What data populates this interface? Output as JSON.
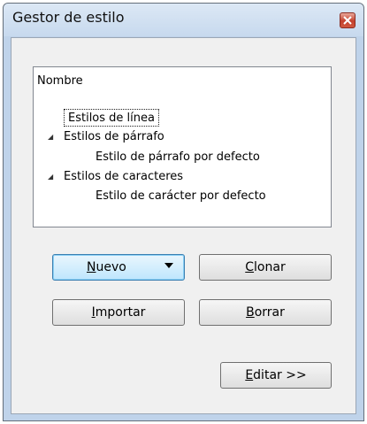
{
  "window": {
    "title": "Gestor de estilo"
  },
  "tree": {
    "header": "Nombre",
    "items": [
      {
        "label": "Estilos de línea",
        "level": 0,
        "expanded": false,
        "selected": true
      },
      {
        "label": "Estilos de párrafo",
        "level": 0,
        "expanded": true,
        "selected": false
      },
      {
        "label": "Estilo de párrafo por defecto",
        "level": 1,
        "selected": false
      },
      {
        "label": "Estilos de caracteres",
        "level": 0,
        "expanded": true,
        "selected": false
      },
      {
        "label": "Estilo de carácter por defecto",
        "level": 1,
        "selected": false
      }
    ]
  },
  "buttons": {
    "nuevo": {
      "label": "Nuevo",
      "mnemonic": "N",
      "rest": "uevo"
    },
    "clonar": {
      "label": "Clonar",
      "mnemonic": "C",
      "rest": "lonar"
    },
    "importar": {
      "label": "Importar",
      "mnemonic": "I",
      "rest": "mportar"
    },
    "borrar": {
      "label": "Borrar",
      "mnemonic": "B",
      "rest": "orrar"
    },
    "editar": {
      "label": "Editar >>",
      "mnemonic": "E",
      "rest": "ditar >>"
    }
  },
  "icons": {
    "close": "close-icon",
    "expanded": "expanded-triangle-icon",
    "dropdown": "dropdown-arrow-icon"
  },
  "colors": {
    "close_button": "#c4402d",
    "default_button": "#bee6fd",
    "titlebar": "#c7d9ee"
  }
}
